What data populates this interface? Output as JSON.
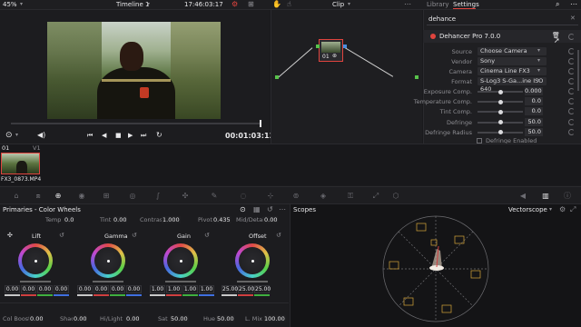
{
  "topbar": {
    "zoom": "45%",
    "timeline_name": "Timeline 1",
    "timecode": "17:46:03:17",
    "clip_label": "Clip",
    "tabs": [
      "Library",
      "Settings"
    ]
  },
  "viewer": {
    "timecode": "00:01:03:13"
  },
  "node": {
    "label": "01"
  },
  "settings": {
    "search_value": "dehance",
    "plugin_name": "Dehancer Pro 7.0.0",
    "fields": [
      {
        "label": "Source",
        "value": "Choose Camera"
      },
      {
        "label": "Vendor",
        "value": "Sony"
      },
      {
        "label": "Camera",
        "value": "Cinema Line FX3"
      },
      {
        "label": "Format",
        "value": "S-Log3 S-Ga...ine ISO 640"
      }
    ],
    "sliders": [
      {
        "label": "Exposure Comp.",
        "value": "0.000",
        "level": 0.5
      },
      {
        "label": "Temperature Comp.",
        "value": "0.0",
        "level": 0.5
      },
      {
        "label": "Tint Comp.",
        "value": "0.0",
        "level": 0.5
      },
      {
        "label": "Defringe",
        "value": "50.0",
        "level": 0.5
      },
      {
        "label": "Defringe Radius",
        "value": "50.0",
        "level": 0.5
      }
    ],
    "checkbox_label": "Defringe Enabled"
  },
  "timeline": {
    "track_num": "01",
    "track_name": "V1",
    "clip_name": "FX3_0873.MP4"
  },
  "primaries": {
    "title": "Primaries - Color Wheels",
    "top_params": [
      {
        "label": "Temp",
        "value": "0.0"
      },
      {
        "label": "Tint",
        "value": "0.00"
      },
      {
        "label": "Contrast",
        "value": "1.000"
      },
      {
        "label": "Pivot",
        "value": "0.435"
      },
      {
        "label": "Mid/Detail",
        "value": "0.00"
      }
    ],
    "wheels": [
      {
        "name": "Lift",
        "values": [
          "0.00",
          "0.00",
          "0.00",
          "0.00"
        ]
      },
      {
        "name": "Gamma",
        "values": [
          "0.00",
          "0.00",
          "0.00",
          "0.00"
        ]
      },
      {
        "name": "Gain",
        "values": [
          "1.00",
          "1.00",
          "1.00",
          "1.00"
        ]
      },
      {
        "name": "Offset",
        "values": [
          "25.00",
          "25.00",
          "25.00",
          ""
        ]
      }
    ],
    "bottom_params": [
      {
        "label": "Col Boost",
        "value": "0.00"
      },
      {
        "label": "Shad",
        "value": "0.00"
      },
      {
        "label": "Hi/Light",
        "value": "0.00"
      },
      {
        "label": "Sat",
        "value": "50.00"
      },
      {
        "label": "Hue",
        "value": "50.00"
      },
      {
        "label": "L. Mix",
        "value": "100.00"
      }
    ]
  },
  "scopes": {
    "title": "Scopes",
    "mode": "Vectorscope"
  },
  "colors": {
    "accent_red": "#e0443e",
    "node_green": "#58c34b",
    "panel_bg": "#1a1a1d"
  }
}
